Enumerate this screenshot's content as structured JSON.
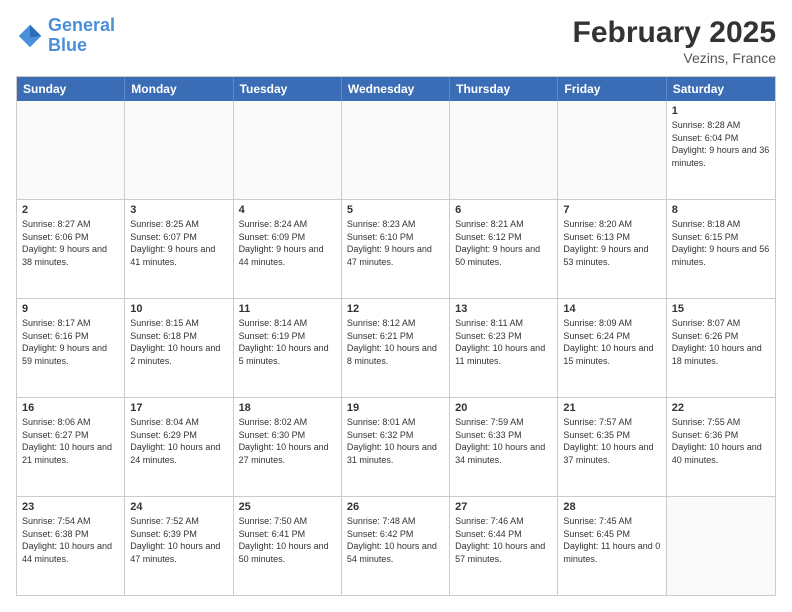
{
  "logo": {
    "line1": "General",
    "line2": "Blue"
  },
  "title": "February 2025",
  "location": "Vezins, France",
  "header_days": [
    "Sunday",
    "Monday",
    "Tuesday",
    "Wednesday",
    "Thursday",
    "Friday",
    "Saturday"
  ],
  "rows": [
    [
      {
        "day": "",
        "info": "",
        "empty": true
      },
      {
        "day": "",
        "info": "",
        "empty": true
      },
      {
        "day": "",
        "info": "",
        "empty": true
      },
      {
        "day": "",
        "info": "",
        "empty": true
      },
      {
        "day": "",
        "info": "",
        "empty": true
      },
      {
        "day": "",
        "info": "",
        "empty": true
      },
      {
        "day": "1",
        "info": "Sunrise: 8:28 AM\nSunset: 6:04 PM\nDaylight: 9 hours and 36 minutes.",
        "empty": false
      }
    ],
    [
      {
        "day": "2",
        "info": "Sunrise: 8:27 AM\nSunset: 6:06 PM\nDaylight: 9 hours and 38 minutes.",
        "empty": false
      },
      {
        "day": "3",
        "info": "Sunrise: 8:25 AM\nSunset: 6:07 PM\nDaylight: 9 hours and 41 minutes.",
        "empty": false
      },
      {
        "day": "4",
        "info": "Sunrise: 8:24 AM\nSunset: 6:09 PM\nDaylight: 9 hours and 44 minutes.",
        "empty": false
      },
      {
        "day": "5",
        "info": "Sunrise: 8:23 AM\nSunset: 6:10 PM\nDaylight: 9 hours and 47 minutes.",
        "empty": false
      },
      {
        "day": "6",
        "info": "Sunrise: 8:21 AM\nSunset: 6:12 PM\nDaylight: 9 hours and 50 minutes.",
        "empty": false
      },
      {
        "day": "7",
        "info": "Sunrise: 8:20 AM\nSunset: 6:13 PM\nDaylight: 9 hours and 53 minutes.",
        "empty": false
      },
      {
        "day": "8",
        "info": "Sunrise: 8:18 AM\nSunset: 6:15 PM\nDaylight: 9 hours and 56 minutes.",
        "empty": false
      }
    ],
    [
      {
        "day": "9",
        "info": "Sunrise: 8:17 AM\nSunset: 6:16 PM\nDaylight: 9 hours and 59 minutes.",
        "empty": false
      },
      {
        "day": "10",
        "info": "Sunrise: 8:15 AM\nSunset: 6:18 PM\nDaylight: 10 hours and 2 minutes.",
        "empty": false
      },
      {
        "day": "11",
        "info": "Sunrise: 8:14 AM\nSunset: 6:19 PM\nDaylight: 10 hours and 5 minutes.",
        "empty": false
      },
      {
        "day": "12",
        "info": "Sunrise: 8:12 AM\nSunset: 6:21 PM\nDaylight: 10 hours and 8 minutes.",
        "empty": false
      },
      {
        "day": "13",
        "info": "Sunrise: 8:11 AM\nSunset: 6:23 PM\nDaylight: 10 hours and 11 minutes.",
        "empty": false
      },
      {
        "day": "14",
        "info": "Sunrise: 8:09 AM\nSunset: 6:24 PM\nDaylight: 10 hours and 15 minutes.",
        "empty": false
      },
      {
        "day": "15",
        "info": "Sunrise: 8:07 AM\nSunset: 6:26 PM\nDaylight: 10 hours and 18 minutes.",
        "empty": false
      }
    ],
    [
      {
        "day": "16",
        "info": "Sunrise: 8:06 AM\nSunset: 6:27 PM\nDaylight: 10 hours and 21 minutes.",
        "empty": false
      },
      {
        "day": "17",
        "info": "Sunrise: 8:04 AM\nSunset: 6:29 PM\nDaylight: 10 hours and 24 minutes.",
        "empty": false
      },
      {
        "day": "18",
        "info": "Sunrise: 8:02 AM\nSunset: 6:30 PM\nDaylight: 10 hours and 27 minutes.",
        "empty": false
      },
      {
        "day": "19",
        "info": "Sunrise: 8:01 AM\nSunset: 6:32 PM\nDaylight: 10 hours and 31 minutes.",
        "empty": false
      },
      {
        "day": "20",
        "info": "Sunrise: 7:59 AM\nSunset: 6:33 PM\nDaylight: 10 hours and 34 minutes.",
        "empty": false
      },
      {
        "day": "21",
        "info": "Sunrise: 7:57 AM\nSunset: 6:35 PM\nDaylight: 10 hours and 37 minutes.",
        "empty": false
      },
      {
        "day": "22",
        "info": "Sunrise: 7:55 AM\nSunset: 6:36 PM\nDaylight: 10 hours and 40 minutes.",
        "empty": false
      }
    ],
    [
      {
        "day": "23",
        "info": "Sunrise: 7:54 AM\nSunset: 6:38 PM\nDaylight: 10 hours and 44 minutes.",
        "empty": false
      },
      {
        "day": "24",
        "info": "Sunrise: 7:52 AM\nSunset: 6:39 PM\nDaylight: 10 hours and 47 minutes.",
        "empty": false
      },
      {
        "day": "25",
        "info": "Sunrise: 7:50 AM\nSunset: 6:41 PM\nDaylight: 10 hours and 50 minutes.",
        "empty": false
      },
      {
        "day": "26",
        "info": "Sunrise: 7:48 AM\nSunset: 6:42 PM\nDaylight: 10 hours and 54 minutes.",
        "empty": false
      },
      {
        "day": "27",
        "info": "Sunrise: 7:46 AM\nSunset: 6:44 PM\nDaylight: 10 hours and 57 minutes.",
        "empty": false
      },
      {
        "day": "28",
        "info": "Sunrise: 7:45 AM\nSunset: 6:45 PM\nDaylight: 11 hours and 0 minutes.",
        "empty": false
      },
      {
        "day": "",
        "info": "",
        "empty": true
      }
    ]
  ]
}
